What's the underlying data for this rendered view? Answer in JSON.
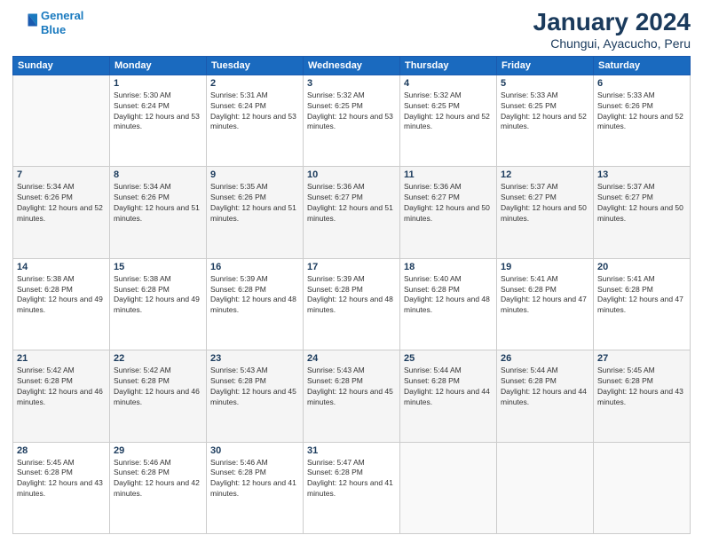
{
  "header": {
    "logo_line1": "General",
    "logo_line2": "Blue",
    "month_title": "January 2024",
    "location": "Chungui, Ayacucho, Peru"
  },
  "weekdays": [
    "Sunday",
    "Monday",
    "Tuesday",
    "Wednesday",
    "Thursday",
    "Friday",
    "Saturday"
  ],
  "weeks": [
    [
      {
        "day": "",
        "sunrise": "",
        "sunset": "",
        "daylight": ""
      },
      {
        "day": "1",
        "sunrise": "Sunrise: 5:30 AM",
        "sunset": "Sunset: 6:24 PM",
        "daylight": "Daylight: 12 hours and 53 minutes."
      },
      {
        "day": "2",
        "sunrise": "Sunrise: 5:31 AM",
        "sunset": "Sunset: 6:24 PM",
        "daylight": "Daylight: 12 hours and 53 minutes."
      },
      {
        "day": "3",
        "sunrise": "Sunrise: 5:32 AM",
        "sunset": "Sunset: 6:25 PM",
        "daylight": "Daylight: 12 hours and 53 minutes."
      },
      {
        "day": "4",
        "sunrise": "Sunrise: 5:32 AM",
        "sunset": "Sunset: 6:25 PM",
        "daylight": "Daylight: 12 hours and 52 minutes."
      },
      {
        "day": "5",
        "sunrise": "Sunrise: 5:33 AM",
        "sunset": "Sunset: 6:25 PM",
        "daylight": "Daylight: 12 hours and 52 minutes."
      },
      {
        "day": "6",
        "sunrise": "Sunrise: 5:33 AM",
        "sunset": "Sunset: 6:26 PM",
        "daylight": "Daylight: 12 hours and 52 minutes."
      }
    ],
    [
      {
        "day": "7",
        "sunrise": "Sunrise: 5:34 AM",
        "sunset": "Sunset: 6:26 PM",
        "daylight": "Daylight: 12 hours and 52 minutes."
      },
      {
        "day": "8",
        "sunrise": "Sunrise: 5:34 AM",
        "sunset": "Sunset: 6:26 PM",
        "daylight": "Daylight: 12 hours and 51 minutes."
      },
      {
        "day": "9",
        "sunrise": "Sunrise: 5:35 AM",
        "sunset": "Sunset: 6:26 PM",
        "daylight": "Daylight: 12 hours and 51 minutes."
      },
      {
        "day": "10",
        "sunrise": "Sunrise: 5:36 AM",
        "sunset": "Sunset: 6:27 PM",
        "daylight": "Daylight: 12 hours and 51 minutes."
      },
      {
        "day": "11",
        "sunrise": "Sunrise: 5:36 AM",
        "sunset": "Sunset: 6:27 PM",
        "daylight": "Daylight: 12 hours and 50 minutes."
      },
      {
        "day": "12",
        "sunrise": "Sunrise: 5:37 AM",
        "sunset": "Sunset: 6:27 PM",
        "daylight": "Daylight: 12 hours and 50 minutes."
      },
      {
        "day": "13",
        "sunrise": "Sunrise: 5:37 AM",
        "sunset": "Sunset: 6:27 PM",
        "daylight": "Daylight: 12 hours and 50 minutes."
      }
    ],
    [
      {
        "day": "14",
        "sunrise": "Sunrise: 5:38 AM",
        "sunset": "Sunset: 6:28 PM",
        "daylight": "Daylight: 12 hours and 49 minutes."
      },
      {
        "day": "15",
        "sunrise": "Sunrise: 5:38 AM",
        "sunset": "Sunset: 6:28 PM",
        "daylight": "Daylight: 12 hours and 49 minutes."
      },
      {
        "day": "16",
        "sunrise": "Sunrise: 5:39 AM",
        "sunset": "Sunset: 6:28 PM",
        "daylight": "Daylight: 12 hours and 48 minutes."
      },
      {
        "day": "17",
        "sunrise": "Sunrise: 5:39 AM",
        "sunset": "Sunset: 6:28 PM",
        "daylight": "Daylight: 12 hours and 48 minutes."
      },
      {
        "day": "18",
        "sunrise": "Sunrise: 5:40 AM",
        "sunset": "Sunset: 6:28 PM",
        "daylight": "Daylight: 12 hours and 48 minutes."
      },
      {
        "day": "19",
        "sunrise": "Sunrise: 5:41 AM",
        "sunset": "Sunset: 6:28 PM",
        "daylight": "Daylight: 12 hours and 47 minutes."
      },
      {
        "day": "20",
        "sunrise": "Sunrise: 5:41 AM",
        "sunset": "Sunset: 6:28 PM",
        "daylight": "Daylight: 12 hours and 47 minutes."
      }
    ],
    [
      {
        "day": "21",
        "sunrise": "Sunrise: 5:42 AM",
        "sunset": "Sunset: 6:28 PM",
        "daylight": "Daylight: 12 hours and 46 minutes."
      },
      {
        "day": "22",
        "sunrise": "Sunrise: 5:42 AM",
        "sunset": "Sunset: 6:28 PM",
        "daylight": "Daylight: 12 hours and 46 minutes."
      },
      {
        "day": "23",
        "sunrise": "Sunrise: 5:43 AM",
        "sunset": "Sunset: 6:28 PM",
        "daylight": "Daylight: 12 hours and 45 minutes."
      },
      {
        "day": "24",
        "sunrise": "Sunrise: 5:43 AM",
        "sunset": "Sunset: 6:28 PM",
        "daylight": "Daylight: 12 hours and 45 minutes."
      },
      {
        "day": "25",
        "sunrise": "Sunrise: 5:44 AM",
        "sunset": "Sunset: 6:28 PM",
        "daylight": "Daylight: 12 hours and 44 minutes."
      },
      {
        "day": "26",
        "sunrise": "Sunrise: 5:44 AM",
        "sunset": "Sunset: 6:28 PM",
        "daylight": "Daylight: 12 hours and 44 minutes."
      },
      {
        "day": "27",
        "sunrise": "Sunrise: 5:45 AM",
        "sunset": "Sunset: 6:28 PM",
        "daylight": "Daylight: 12 hours and 43 minutes."
      }
    ],
    [
      {
        "day": "28",
        "sunrise": "Sunrise: 5:45 AM",
        "sunset": "Sunset: 6:28 PM",
        "daylight": "Daylight: 12 hours and 43 minutes."
      },
      {
        "day": "29",
        "sunrise": "Sunrise: 5:46 AM",
        "sunset": "Sunset: 6:28 PM",
        "daylight": "Daylight: 12 hours and 42 minutes."
      },
      {
        "day": "30",
        "sunrise": "Sunrise: 5:46 AM",
        "sunset": "Sunset: 6:28 PM",
        "daylight": "Daylight: 12 hours and 41 minutes."
      },
      {
        "day": "31",
        "sunrise": "Sunrise: 5:47 AM",
        "sunset": "Sunset: 6:28 PM",
        "daylight": "Daylight: 12 hours and 41 minutes."
      },
      {
        "day": "",
        "sunrise": "",
        "sunset": "",
        "daylight": ""
      },
      {
        "day": "",
        "sunrise": "",
        "sunset": "",
        "daylight": ""
      },
      {
        "day": "",
        "sunrise": "",
        "sunset": "",
        "daylight": ""
      }
    ]
  ]
}
